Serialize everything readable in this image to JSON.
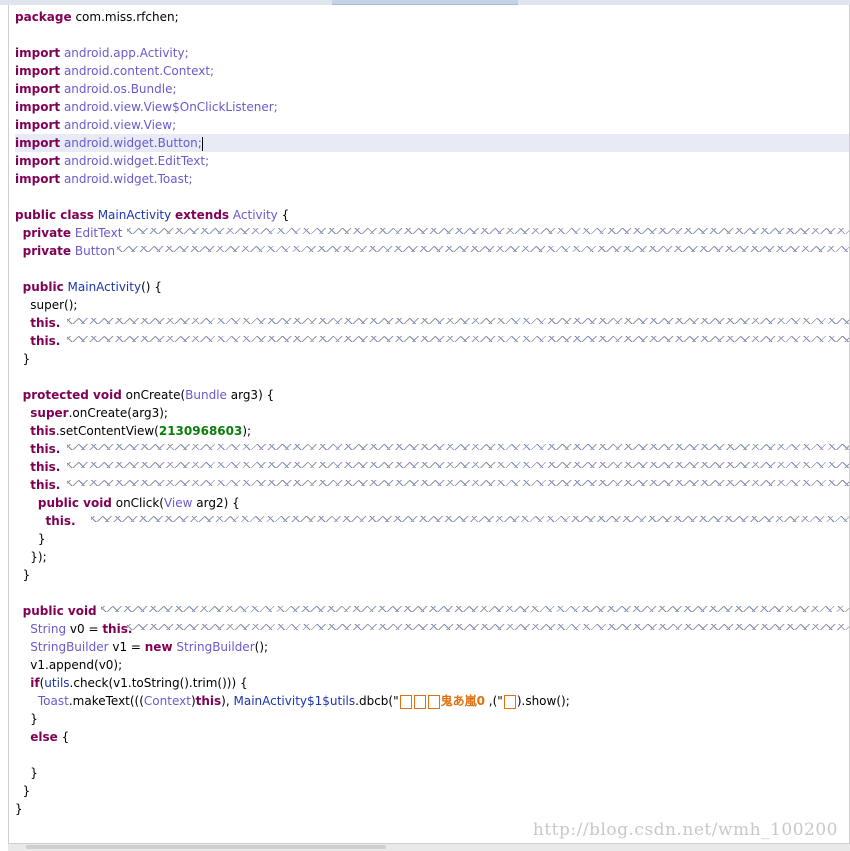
{
  "code": {
    "package_kw": "package",
    "package_name": "com.miss.rfchen;",
    "import_kw": "import",
    "imports": [
      "android.app.Activity;",
      "android.content.Context;",
      "android.os.Bundle;",
      "android.view.View$OnClickListener;",
      "android.view.View;",
      "android.widget.Button;",
      "android.widget.EditText;",
      "android.widget.Toast;"
    ],
    "class_decl": {
      "kw1": "public class",
      "name": "MainActivity",
      "kw2": "extends",
      "parent": "Activity",
      "brace": " {"
    },
    "field_kw": "private",
    "fields": [
      "EditText",
      "Button"
    ],
    "ctor": {
      "kw": "public",
      "name": "MainActivity",
      "rest": "() {",
      "super": "super();",
      "this": "this."
    },
    "oncreate": {
      "kw": "protected void",
      "name": "onCreate",
      "param_type": "Bundle",
      "param": " arg3) {",
      "super_kw": "super",
      "super_rest": ".onCreate(arg3);",
      "this": "this",
      "set_content": ".setContentView(",
      "layout_id": "2130968603",
      "set_content_end": ");",
      "this_dot": "this.",
      "onclick_kw": "public void",
      "onclick_name": "onClick",
      "onclick_type": "View",
      "onclick_param": " arg2) {",
      "close1": "}",
      "close2": "});",
      "close3": "}"
    },
    "check": {
      "kw": "public void",
      "string_type": "String",
      "v0_assign": " v0 = ",
      "this_dot": "this.",
      "sb_type": "StringBuilder",
      "v1_assign": " v1 = ",
      "new_kw": "new",
      "sb_ctor": "StringBuilder",
      "sb_end": "();",
      "append": "v1.append(v0);",
      "if_kw": "if",
      "if_open": "(",
      "utils": "utils",
      "check_call": ".check(v1.toString().trim())) {",
      "toast": "Toast",
      "make_text": ".makeText(((",
      "context": "Context",
      "cast_close": ")",
      "this_kw": "this",
      "after_this": "), ",
      "utils_ref": "MainActivity$1$utils",
      "dbcb": ".dbcb(\"",
      "garbled": "鬼あ嵐0",
      "mid": " ,(\"",
      "show": ").show();",
      "close_if": "}",
      "else_kw": "else",
      "else_brace": " {",
      "close_else": "}",
      "close_method": "}",
      "close_class": "}"
    }
  },
  "watermark": "http://blog.csdn.net/wmh_100200",
  "colors": {
    "keyword": "#7f0055",
    "package": "#6a5acd",
    "class": "#1a35b0",
    "number": "#0b7d0b",
    "current_line": "#e8eaf6"
  }
}
